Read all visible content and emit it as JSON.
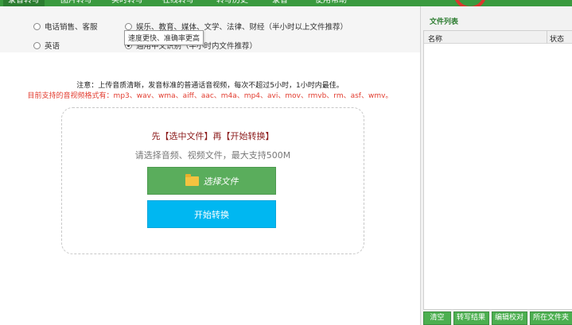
{
  "nav": {
    "tabs": [
      "录音转写",
      "图片转写",
      "实时转写",
      "在线转写",
      "转写历史",
      "录音",
      "使用帮助"
    ],
    "active_index": 0
  },
  "options": {
    "row1": [
      {
        "label": "电话销售、客服",
        "checked": false
      },
      {
        "label": "娱乐、教育、媒体、文学、法律、财经（半小时以上文件推荐）",
        "checked": false
      }
    ],
    "row2": [
      {
        "label": "英语",
        "checked": false
      },
      {
        "label": "通用中文识别（半小时内文件推荐）",
        "checked": true
      }
    ],
    "tooltip": "速度更快、准确率更高"
  },
  "notes": {
    "line1": "注意：上传音质清晰，发音标准的普通话音视频，每次不超过5小时，1小时内最佳。",
    "line2": "目前支持的音视频格式有：mp3、wav、wma、aiff、aac、m4a、mp4、avi、mov、rmvb、rm、asf、wmv。"
  },
  "drop": {
    "title": "先【选中文件】再【开始转换】",
    "hint": "请选择音频、视频文件，最大支持500M",
    "select_label": "选择文件",
    "start_label": "开始转换"
  },
  "file_panel": {
    "title": "文件列表",
    "columns": {
      "name": "名称",
      "status": "状态"
    },
    "buttons": [
      "清空",
      "转写结果",
      "编辑校对",
      "所在文件夹"
    ]
  },
  "colors": {
    "nav_green": "#3a9a3f",
    "select_green": "#5aad5c",
    "start_blue": "#00b7f1",
    "warning_red": "#e23b2e",
    "title_dark_red": "#8b1a1a"
  }
}
